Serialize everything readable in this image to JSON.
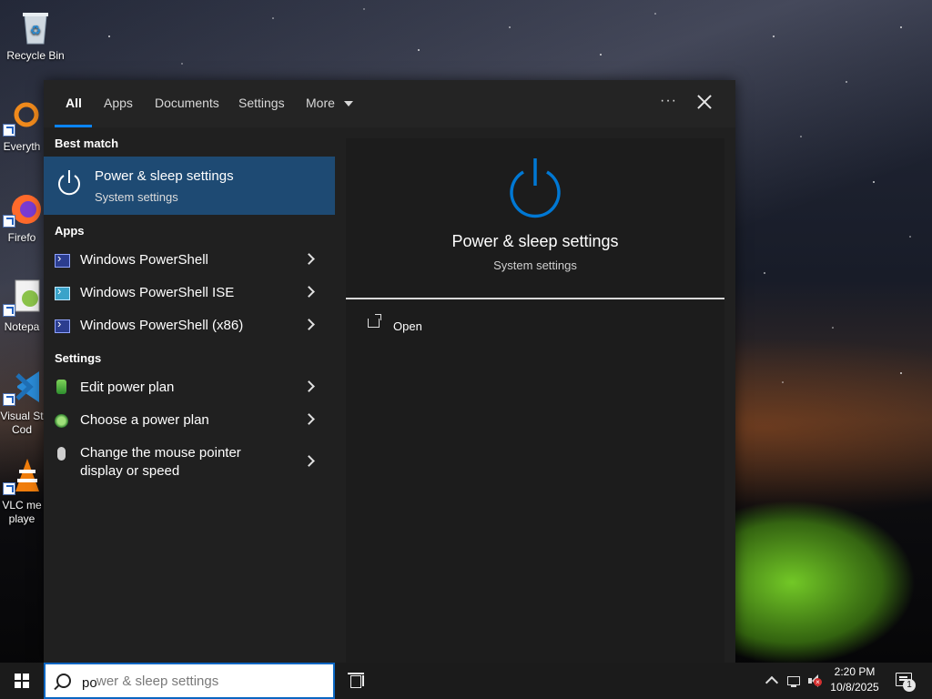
{
  "desktop": {
    "icons": [
      {
        "label": "Recycle Bin",
        "icon": "recycle-bin-icon"
      },
      {
        "label": "Everyth",
        "icon": "everything-search-icon"
      },
      {
        "label": "Firefo",
        "icon": "firefox-icon"
      },
      {
        "label": "Notepa",
        "icon": "notepad-plus-plus-icon"
      },
      {
        "label": "Visual St",
        "label2": "Cod",
        "icon": "vscode-icon"
      },
      {
        "label": "VLC me",
        "label2": "playe",
        "icon": "vlc-icon"
      }
    ]
  },
  "search_panel": {
    "tabs": [
      {
        "label": "All",
        "active": true
      },
      {
        "label": "Apps"
      },
      {
        "label": "Documents"
      },
      {
        "label": "Settings"
      },
      {
        "label": "More"
      }
    ],
    "more_icon": "chevron-down-icon",
    "ellipsis": "···",
    "best_match": {
      "heading": "Best match",
      "title": "Power & sleep settings",
      "subtitle": "System settings",
      "icon": "power-icon"
    },
    "apps": {
      "heading": "Apps",
      "items": [
        {
          "label": "Windows PowerShell",
          "icon": "powershell-icon"
        },
        {
          "label": "Windows PowerShell ISE",
          "icon": "powershell-ise-icon"
        },
        {
          "label": "Windows PowerShell (x86)",
          "icon": "powershell-icon"
        }
      ]
    },
    "settings": {
      "heading": "Settings",
      "items": [
        {
          "label": "Edit power plan",
          "icon": "power-plan-icon"
        },
        {
          "label": "Choose a power plan",
          "icon": "power-options-icon"
        },
        {
          "label": "Change the mouse pointer",
          "label2": "display or speed",
          "icon": "mouse-icon"
        }
      ]
    },
    "preview": {
      "title": "Power & sleep settings",
      "subtitle": "System settings",
      "actions": [
        {
          "label": "Open",
          "icon": "open-icon"
        }
      ],
      "accent": "#0078d4"
    }
  },
  "taskbar": {
    "search": {
      "value": "po",
      "suggestion": "wer & sleep settings"
    },
    "clock": {
      "time": "2:20 PM",
      "date": "10/8/2025"
    },
    "notification_count": "1"
  },
  "colors": {
    "panel_bg": "#202020",
    "selection": "#1e4a73",
    "accent": "#0a84ff"
  }
}
